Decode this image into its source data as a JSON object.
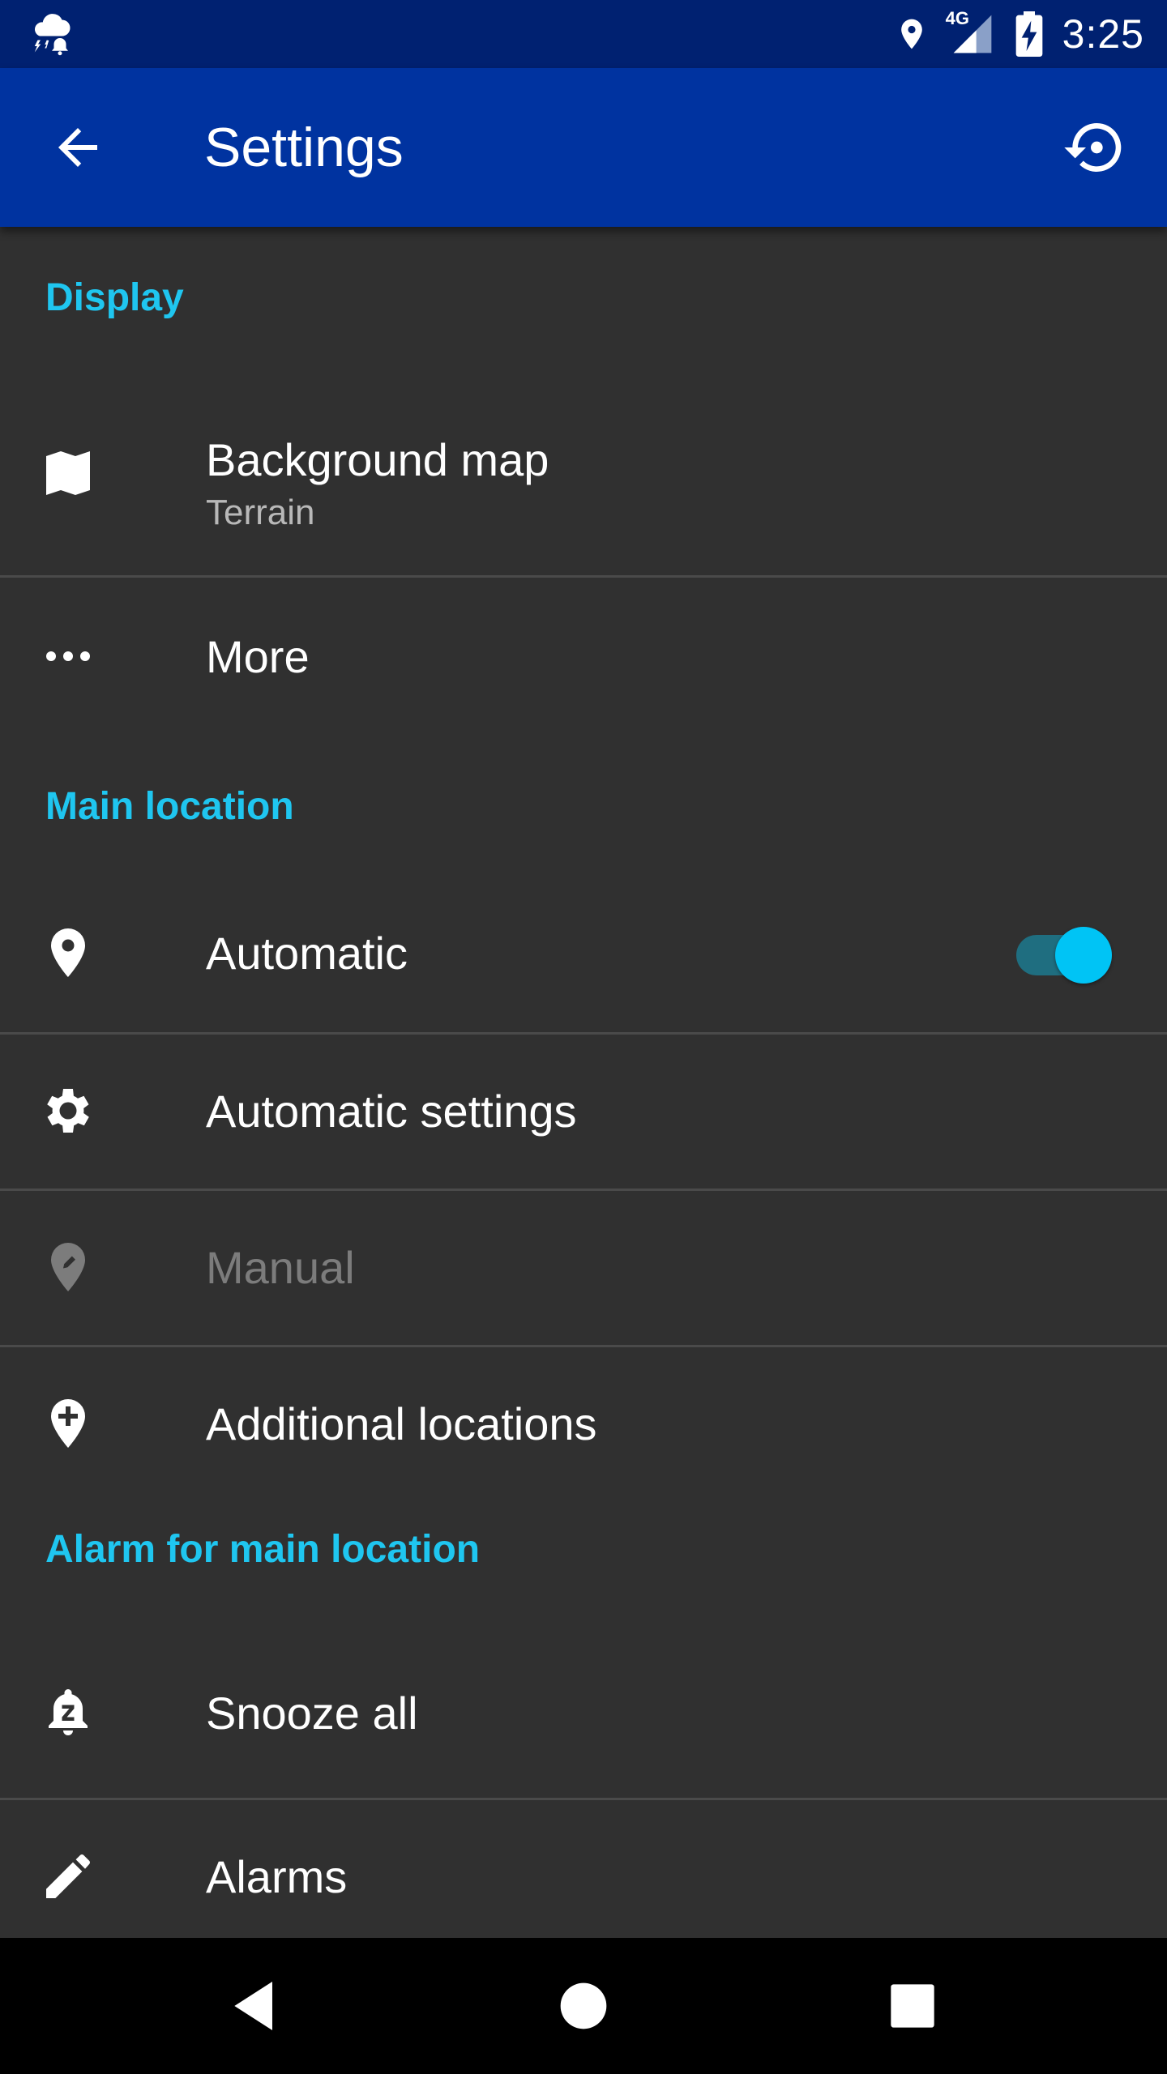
{
  "status_bar": {
    "time": "3:25",
    "network": "4G",
    "icons": [
      "weather-alert-icon",
      "location-pin-icon",
      "signal-icon",
      "battery-charging-icon"
    ]
  },
  "app_bar": {
    "title": "Settings",
    "back_icon": "arrow-back-icon",
    "action_icon": "restore-icon"
  },
  "sections": {
    "display": {
      "header": "Display",
      "background_map": {
        "label": "Background map",
        "summary": "Terrain",
        "icon": "map-icon"
      },
      "more": {
        "label": "More",
        "icon": "more-horiz-icon"
      }
    },
    "main_location": {
      "header": "Main location",
      "automatic": {
        "label": "Automatic",
        "icon": "location-pin-icon",
        "enabled": true
      },
      "automatic_settings": {
        "label": "Automatic settings",
        "icon": "gear-icon"
      },
      "manual": {
        "label": "Manual",
        "icon": "edit-location-icon",
        "disabled": true
      },
      "additional_locations": {
        "label": "Additional locations",
        "icon": "add-location-icon"
      }
    },
    "alarm": {
      "header": "Alarm for main location",
      "snooze_all": {
        "label": "Snooze all",
        "icon": "snooze-icon"
      },
      "alarms": {
        "label": "Alarms",
        "icon": "pencil-icon"
      }
    }
  },
  "colors": {
    "status_bar": "#002171",
    "app_bar": "#0033a0",
    "background": "#303030",
    "accent": "#1fc6f0",
    "switch_thumb": "#00c4f5"
  },
  "nav_bar": {
    "icons": [
      "back-triangle-icon",
      "home-circle-icon",
      "recents-square-icon"
    ]
  }
}
